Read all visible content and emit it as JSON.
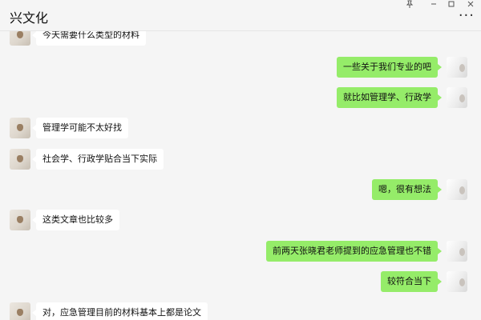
{
  "header": {
    "title": "兴文化",
    "pin_icon": "pin-icon",
    "minimize_icon": "minimize-icon",
    "maximize_icon": "maximize-icon",
    "close_icon": "close-icon",
    "more_icon": "more-options-icon"
  },
  "colors": {
    "chat_background": "#f5f5f5",
    "incoming_bubble": "#ffffff",
    "outgoing_bubble": "#95ec69"
  },
  "messages": [
    {
      "side": "left",
      "text": "今天需要什么类型的材料"
    },
    {
      "side": "right",
      "text": "一些关于我们专业的吧"
    },
    {
      "side": "right",
      "text": "就比如管理学、行政学"
    },
    {
      "side": "left",
      "text": "管理学可能不太好找"
    },
    {
      "side": "left",
      "text": "社会学、行政学贴合当下实际"
    },
    {
      "side": "right",
      "text": "嗯，很有想法"
    },
    {
      "side": "left",
      "text": "这类文章也比较多"
    },
    {
      "side": "right",
      "text": "前两天张晓君老师提到的应急管理也不错"
    },
    {
      "side": "right",
      "text": "较符合当下"
    },
    {
      "side": "left",
      "text": "对，应急管理目前的材料基本上都是论文"
    }
  ]
}
